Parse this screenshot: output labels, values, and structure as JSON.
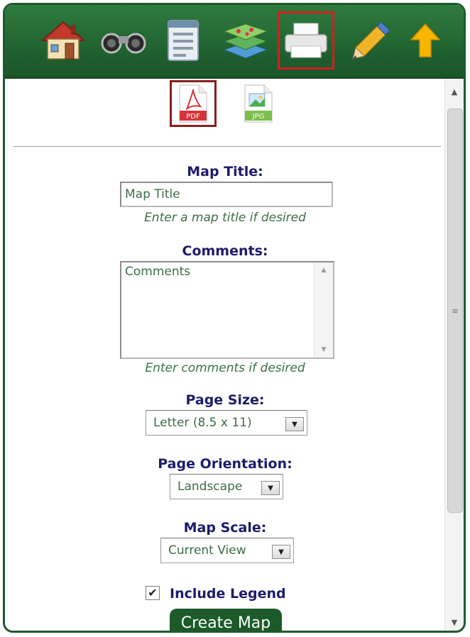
{
  "toolbar": {
    "buttons": [
      {
        "name": "home-icon"
      },
      {
        "name": "binoculars-icon"
      },
      {
        "name": "document-icon"
      },
      {
        "name": "layers-icon"
      },
      {
        "name": "printer-icon",
        "active": true
      },
      {
        "name": "pencil-icon"
      },
      {
        "name": "up-arrow-icon"
      }
    ]
  },
  "formats": {
    "pdf_label": "PDF",
    "jpg_label": "JPG",
    "selected": "PDF"
  },
  "form": {
    "map_title": {
      "label": "Map Title:",
      "value": "Map Title",
      "hint": "Enter a map title if desired"
    },
    "comments": {
      "label": "Comments:",
      "value": "Comments",
      "hint": "Enter comments if desired"
    },
    "page_size": {
      "label": "Page Size:",
      "value": "Letter (8.5 x 11)"
    },
    "page_orientation": {
      "label": "Page Orientation:",
      "value": "Landscape"
    },
    "map_scale": {
      "label": "Map Scale:",
      "value": "Current View"
    },
    "include_legend": {
      "label": "Include Legend",
      "checked": true
    },
    "create_button": "Create Map"
  },
  "colors": {
    "toolbar_green": "#1f5f2f",
    "label_navy": "#1c1c6b",
    "hint_green": "#3c6d46",
    "active_red": "#d21f1f"
  }
}
